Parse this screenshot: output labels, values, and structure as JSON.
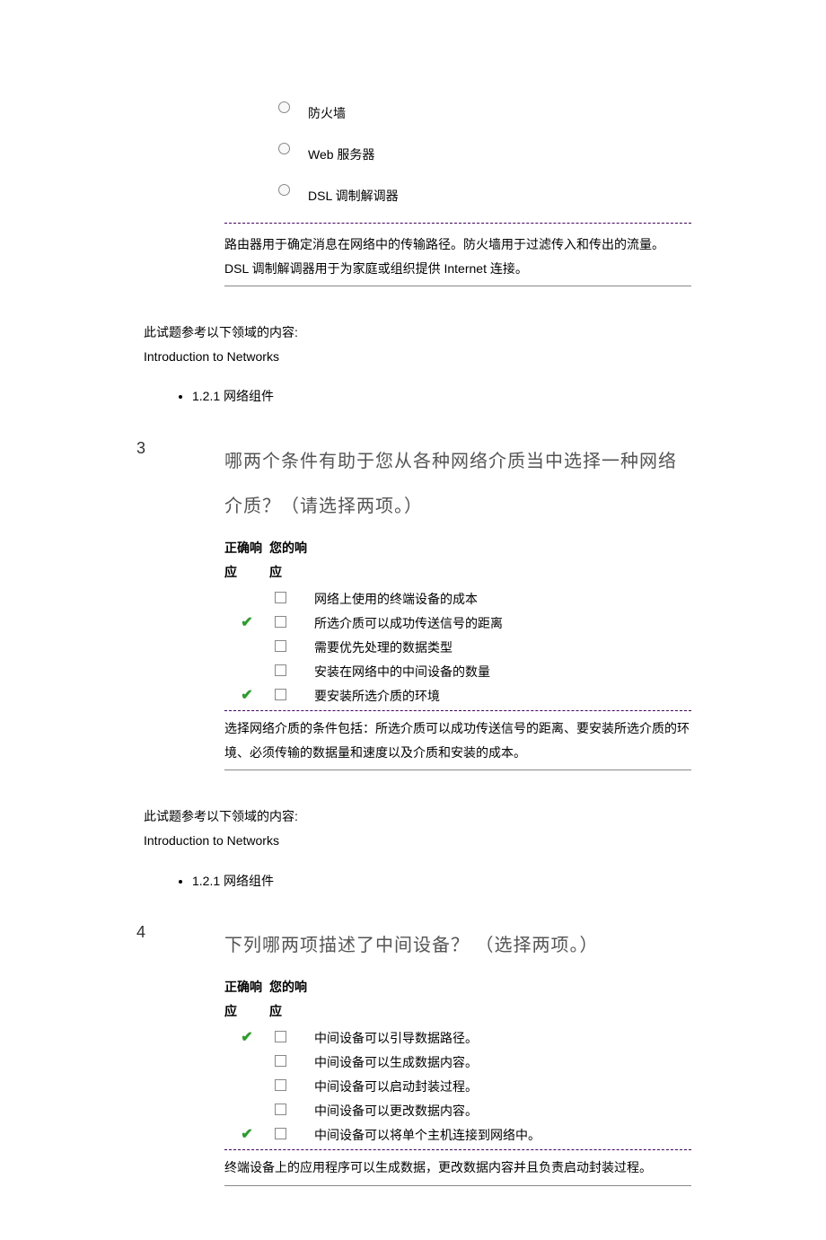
{
  "q2": {
    "radios": [
      {
        "label": "防火墙"
      },
      {
        "label": "Web 服务器"
      },
      {
        "label": "DSL 调制解调器"
      }
    ],
    "explanation": "路由器用于确定消息在网络中的传输路径。防火墙用于过滤传入和传出的流量。 DSL 调制解调器用于为家庭或组织提供 Internet 连接。",
    "reference_intro": "此试题参考以下领域的内容:",
    "reference_course": "Introduction to Networks",
    "reference_item": "1.2.1 网络组件"
  },
  "q3": {
    "number": "3",
    "question": "哪两个条件有助于您从各种网络介质当中选择一种网络介质？（请选择两项。）",
    "col_correct": "正确响应",
    "col_your": "您的响应",
    "options": [
      {
        "correct": false,
        "label": "网络上使用的终端设备的成本"
      },
      {
        "correct": true,
        "label": "所选介质可以成功传送信号的距离"
      },
      {
        "correct": false,
        "label": "需要优先处理的数据类型"
      },
      {
        "correct": false,
        "label": "安装在网络中的中间设备的数量"
      },
      {
        "correct": true,
        "label": "要安装所选介质的环境"
      }
    ],
    "explanation": "选择网络介质的条件包括：所选介质可以成功传送信号的距离、要安装所选介质的环境、必须传输的数据量和速度以及介质和安装的成本。",
    "reference_intro": "此试题参考以下领域的内容:",
    "reference_course": "Introduction to Networks",
    "reference_item": "1.2.1 网络组件"
  },
  "q4": {
    "number": "4",
    "question": "下列哪两项描述了中间设备？ （选择两项。）",
    "col_correct": "正确响应",
    "col_your": "您的响应",
    "options": [
      {
        "correct": true,
        "label": "中间设备可以引导数据路径。"
      },
      {
        "correct": false,
        "label": "中间设备可以生成数据内容。"
      },
      {
        "correct": false,
        "label": "中间设备可以启动封装过程。"
      },
      {
        "correct": false,
        "label": "中间设备可以更改数据内容。"
      },
      {
        "correct": true,
        "label": "中间设备可以将单个主机连接到网络中。"
      }
    ],
    "explanation": "终端设备上的应用程序可以生成数据，更改数据内容并且负责启动封装过程。"
  }
}
